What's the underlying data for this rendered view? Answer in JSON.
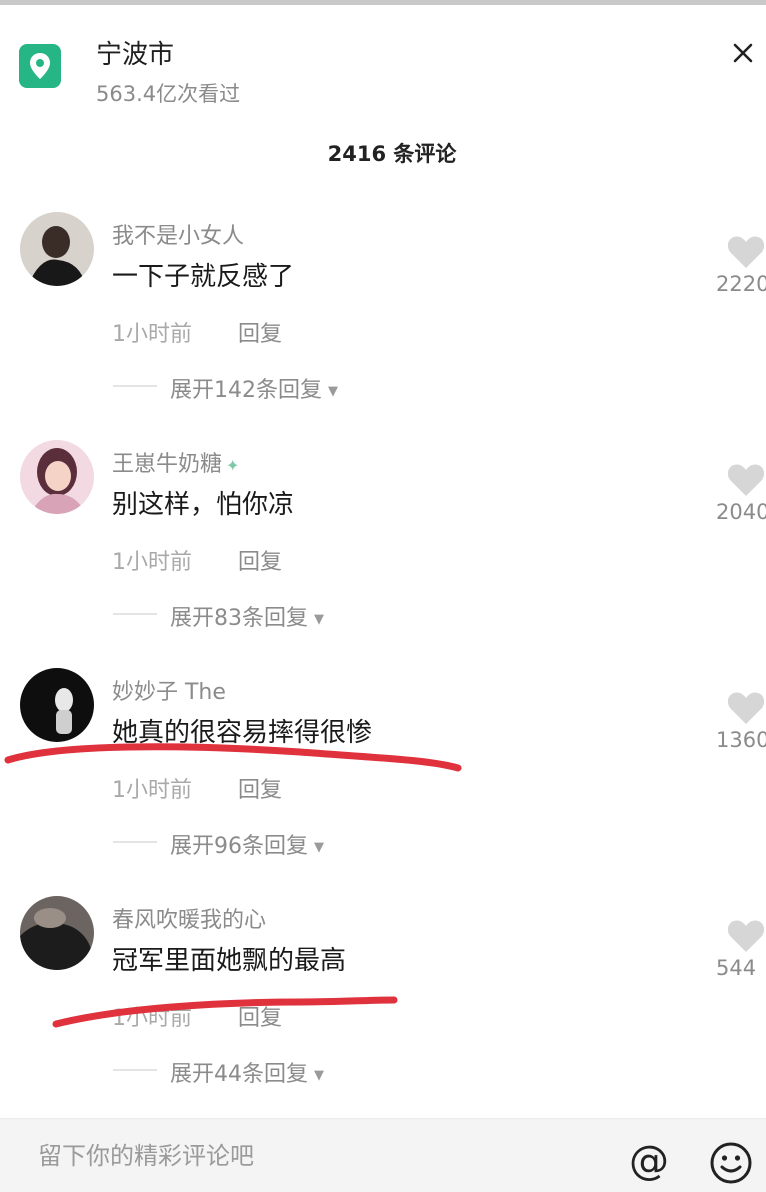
{
  "header": {
    "location": "宁波市",
    "views": "563.4亿次看过",
    "comment_count_title": "2416 条评论"
  },
  "comments": [
    {
      "username": "我不是小女人",
      "text": "一下子就反感了",
      "time": "1小时前",
      "reply_label": "回复",
      "expand_label": "展开142条回复",
      "likes": "2220",
      "avatar_color": "#2b2b2b"
    },
    {
      "username": "王崽牛奶糖",
      "text": "别这样，怕你凉",
      "time": "1小时前",
      "reply_label": "回复",
      "expand_label": "展开83条回复",
      "likes": "2040",
      "avatar_color": "#e9b9c9"
    },
    {
      "username": "妙妙子 The",
      "text": "她真的很容易摔得很惨",
      "time": "1小时前",
      "reply_label": "回复",
      "expand_label": "展开96条回复",
      "likes": "1360",
      "avatar_color": "#111111"
    },
    {
      "username": "春风吹暖我的心",
      "text": "冠军里面她飘的最高",
      "time": "1小时前",
      "reply_label": "回复",
      "expand_label": "展开44条回复",
      "likes": "544",
      "avatar_color": "#3a3a3a"
    }
  ],
  "input": {
    "placeholder": "留下你的精彩评论吧",
    "at_symbol": "@"
  },
  "colors": {
    "brand_green": "#26b584",
    "annotation_red": "#e0323c"
  },
  "icons": [
    "location-pin-icon",
    "close-icon",
    "heart-icon",
    "caret-down-icon",
    "at-icon",
    "emoji-icon"
  ]
}
